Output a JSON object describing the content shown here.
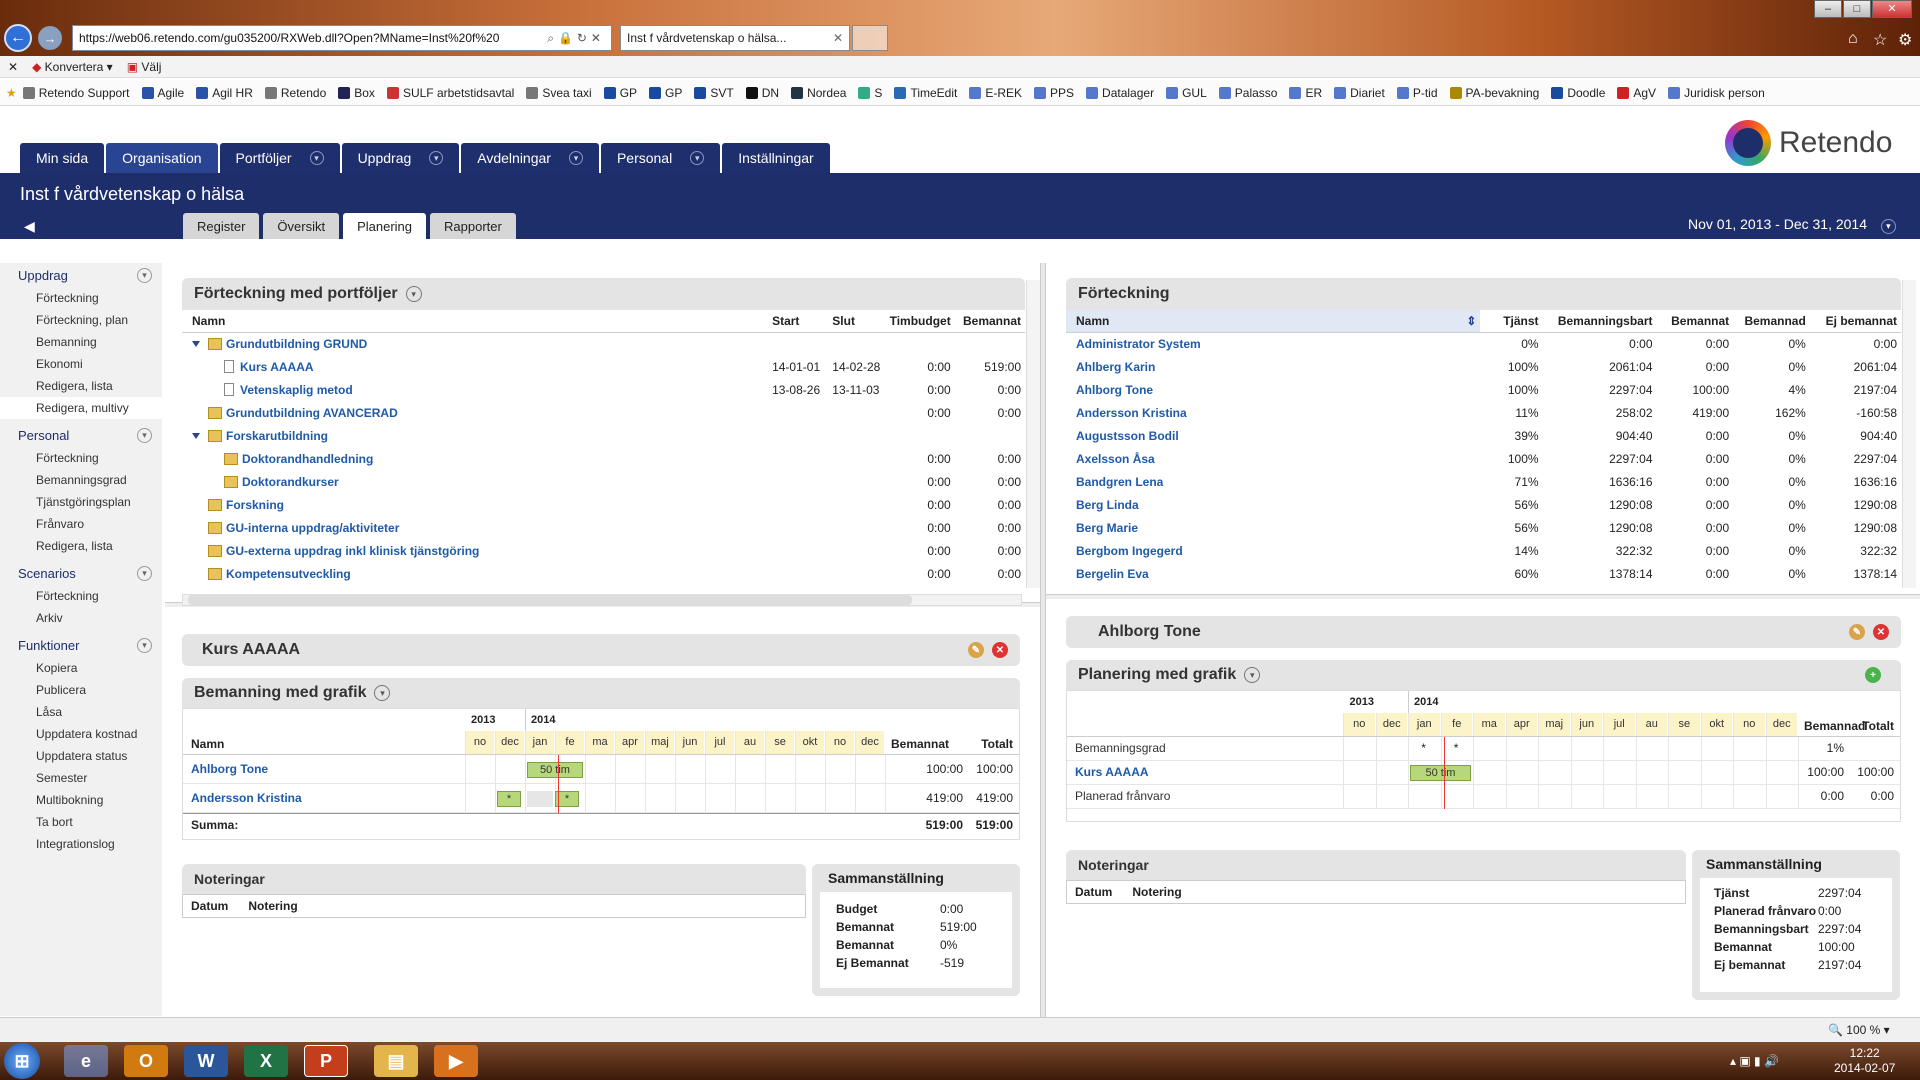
{
  "browser": {
    "url": "https://web06.retendo.com/gu035200/RXWeb.dll?Open?MName=Inst%20f%20",
    "tab_title": "Inst f vårdvetenskap o hälsa...",
    "cmd_konvertera": "Konvertera",
    "cmd_valj": "Välj",
    "favorites": [
      "Retendo Support",
      "Agile",
      "Agil HR",
      "Retendo",
      "Box",
      "SULF arbetstidsavtal",
      "Svea taxi",
      "GP",
      "GP",
      "SVT",
      "DN",
      "Nordea",
      "S",
      "TimeEdit",
      "E-REK",
      "PPS",
      "Datalager",
      "GUL",
      "Palasso",
      "ER",
      "Diariet",
      "P-tid",
      "PA-bevakning",
      "Doodle",
      "AgV",
      "Juridisk person"
    ]
  },
  "app": {
    "logo": "Retendo",
    "nav": [
      "Min sida",
      "Organisation",
      "Portföljer",
      "Uppdrag",
      "Avdelningar",
      "Personal",
      "Inställningar"
    ],
    "org_title": "Inst f vårdvetenskap o hälsa",
    "subtabs": [
      "Register",
      "Översikt",
      "Planering",
      "Rapporter"
    ],
    "date_range": "Nov 01, 2013 - Dec 31, 2014"
  },
  "sidebar": [
    {
      "title": "Uppdrag",
      "items": [
        "Förteckning",
        "Förteckning, plan",
        "Bemanning",
        "Ekonomi",
        "Redigera, lista",
        "Redigera, multivy"
      ]
    },
    {
      "title": "Personal",
      "items": [
        "Förteckning",
        "Bemanningsgrad",
        "Tjänstgöringsplan",
        "Frånvaro",
        "Redigera, lista"
      ]
    },
    {
      "title": "Scenarios",
      "items": [
        "Förteckning",
        "Arkiv"
      ]
    },
    {
      "title": "Funktioner",
      "items": [
        "Kopiera",
        "Publicera",
        "Låsa",
        "Uppdatera kostnad",
        "Uppdatera status",
        "Semester",
        "Multibokning",
        "Ta bort",
        "Integrationslog"
      ]
    }
  ],
  "portfolio": {
    "title": "Förteckning med portföljer",
    "headers": [
      "Namn",
      "Start",
      "Slut",
      "Timbudget",
      "Bemannat"
    ],
    "rows": [
      {
        "name": "Grundutbildning GRUND",
        "level": 0,
        "type": "folder",
        "open": true,
        "start": "",
        "end": "",
        "budget": "",
        "staffed": ""
      },
      {
        "name": "Kurs AAAAA",
        "level": 1,
        "type": "doc",
        "start": "14-01-01",
        "end": "14-02-28",
        "budget": "0:00",
        "staffed": "519:00"
      },
      {
        "name": "Vetenskaplig metod",
        "level": 1,
        "type": "doc",
        "start": "13-08-26",
        "end": "13-11-03",
        "budget": "0:00",
        "staffed": "0:00"
      },
      {
        "name": "Grundutbildning AVANCERAD",
        "level": 0,
        "type": "folder",
        "start": "",
        "end": "",
        "budget": "0:00",
        "staffed": "0:00"
      },
      {
        "name": "Forskarutbildning",
        "level": 0,
        "type": "folder",
        "open": true,
        "start": "",
        "end": "",
        "budget": "",
        "staffed": ""
      },
      {
        "name": "Doktorandhandledning",
        "level": 1,
        "type": "folder",
        "start": "",
        "end": "",
        "budget": "0:00",
        "staffed": "0:00"
      },
      {
        "name": "Doktorandkurser",
        "level": 1,
        "type": "folder",
        "start": "",
        "end": "",
        "budget": "0:00",
        "staffed": "0:00"
      },
      {
        "name": "Forskning",
        "level": 0,
        "type": "folder",
        "start": "",
        "end": "",
        "budget": "0:00",
        "staffed": "0:00"
      },
      {
        "name": "GU-interna uppdrag/aktiviteter",
        "level": 0,
        "type": "folder",
        "start": "",
        "end": "",
        "budget": "0:00",
        "staffed": "0:00"
      },
      {
        "name": "GU-externa uppdrag inkl klinisk tjänstgöring",
        "level": 0,
        "type": "folder",
        "start": "",
        "end": "",
        "budget": "0:00",
        "staffed": "0:00"
      },
      {
        "name": "Kompetensutveckling",
        "level": 0,
        "type": "folder",
        "start": "",
        "end": "",
        "budget": "0:00",
        "staffed": "0:00"
      }
    ]
  },
  "staff": {
    "title": "Förteckning",
    "headers": [
      "Namn",
      "Tjänst",
      "Bemanningsbart",
      "Bemannat",
      "Bemannad",
      "Ej bemannat"
    ],
    "rows": [
      [
        "Administrator System",
        "0%",
        "0:00",
        "0:00",
        "0%",
        "0:00"
      ],
      [
        "Ahlberg Karin",
        "100%",
        "2061:04",
        "0:00",
        "0%",
        "2061:04"
      ],
      [
        "Ahlborg Tone",
        "100%",
        "2297:04",
        "100:00",
        "4%",
        "2197:04"
      ],
      [
        "Andersson Kristina",
        "11%",
        "258:02",
        "419:00",
        "162%",
        "-160:58"
      ],
      [
        "Augustsson Bodil",
        "39%",
        "904:40",
        "0:00",
        "0%",
        "904:40"
      ],
      [
        "Axelsson Åsa",
        "100%",
        "2297:04",
        "0:00",
        "0%",
        "2297:04"
      ],
      [
        "Bandgren Lena",
        "71%",
        "1636:16",
        "0:00",
        "0%",
        "1636:16"
      ],
      [
        "Berg Linda",
        "56%",
        "1290:08",
        "0:00",
        "0%",
        "1290:08"
      ],
      [
        "Berg Marie",
        "56%",
        "1290:08",
        "0:00",
        "0%",
        "1290:08"
      ],
      [
        "Bergbom Ingegerd",
        "14%",
        "322:32",
        "0:00",
        "0%",
        "322:32"
      ],
      [
        "Bergelin Eva",
        "60%",
        "1378:14",
        "0:00",
        "0%",
        "1378:14"
      ]
    ]
  },
  "course": {
    "title": "Kurs AAAAA",
    "staffing_title": "Bemanning med grafik",
    "years": [
      "2013",
      "2014"
    ],
    "months": [
      "no",
      "dec",
      "jan",
      "fe",
      "ma",
      "apr",
      "maj",
      "jun",
      "jul",
      "au",
      "se",
      "okt",
      "no",
      "dec"
    ],
    "col_staffed": "Bemannat",
    "col_total": "Totalt",
    "col_name": "Namn",
    "rows": [
      {
        "name": "Ahlborg Tone",
        "bar": "50 tim",
        "staffed": "100:00",
        "total": "100:00"
      },
      {
        "name": "Andersson Kristina",
        "bar": "*",
        "bar2": "*",
        "staffed": "419:00",
        "total": "419:00"
      }
    ],
    "sum_label": "Summa:",
    "sum_staffed": "519:00",
    "sum_total": "519:00",
    "notes_title": "Noteringar",
    "notes_cols": [
      "Datum",
      "Notering"
    ],
    "summary_title": "Sammanställning",
    "summary": [
      [
        "Budget",
        "0:00"
      ],
      [
        "Bemannat",
        "519:00"
      ],
      [
        "Bemannat",
        "0%"
      ],
      [
        "Ej Bemannat",
        "-519"
      ]
    ]
  },
  "person": {
    "title": "Ahlborg Tone",
    "plan_title": "Planering med grafik",
    "years": [
      "2013",
      "2014"
    ],
    "months": [
      "no",
      "dec",
      "jan",
      "fe",
      "ma",
      "apr",
      "maj",
      "jun",
      "jul",
      "au",
      "se",
      "okt",
      "no",
      "dec"
    ],
    "col_staffed": "Bemannad",
    "col_total": "Totalt",
    "rows": [
      {
        "name": "Bemanningsgrad",
        "link": false,
        "staffed": "1%",
        "total": ""
      },
      {
        "name": "Kurs AAAAA",
        "link": true,
        "bar": "50 tim",
        "staffed": "100:00",
        "total": "100:00"
      },
      {
        "name": "Planerad frånvaro",
        "link": false,
        "staffed": "0:00",
        "total": "0:00"
      }
    ],
    "notes_title": "Noteringar",
    "notes_cols": [
      "Datum",
      "Notering"
    ],
    "summary_title": "Sammanställning",
    "summary": [
      [
        "Tjänst",
        "2297:04"
      ],
      [
        "Planerad frånvaro",
        "0:00"
      ],
      [
        "Bemanningsbart",
        "2297:04"
      ],
      [
        "Bemannat",
        "100:00"
      ],
      [
        "Ej bemannat",
        "2197:04"
      ]
    ]
  },
  "status": {
    "zoom": "100 %"
  },
  "taskbar": {
    "time": "12:22",
    "date": "2014-02-07"
  }
}
